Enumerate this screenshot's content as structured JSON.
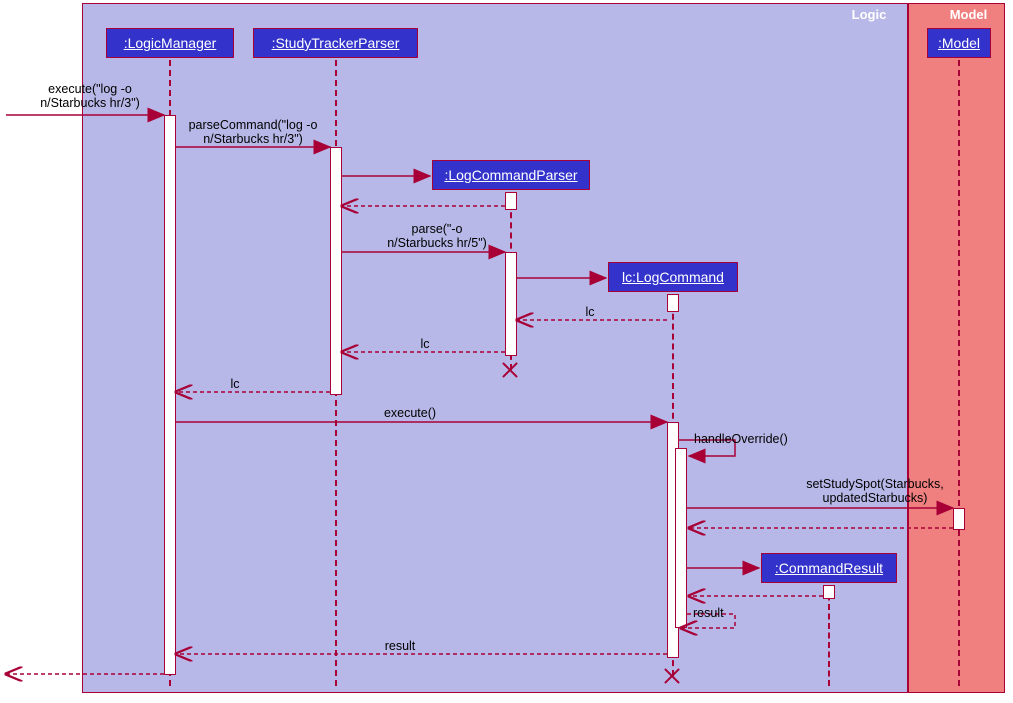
{
  "frames": {
    "logic": {
      "label": "Logic"
    },
    "model": {
      "label": "Model"
    }
  },
  "lifelines": {
    "lm": {
      "label": ":LogicManager"
    },
    "stp": {
      "label": ":StudyTrackerParser"
    },
    "lcp": {
      "label": ":LogCommandParser"
    },
    "lc": {
      "label": "lc:LogCommand"
    },
    "mdl": {
      "label": ":Model"
    },
    "cr": {
      "label": ":CommandResult"
    }
  },
  "messages": {
    "m1": "execute(\"log -o\nn/Starbucks hr/3\")",
    "m2": "parseCommand(\"log -o\nn/Starbucks hr/3\")",
    "m3": "parse(\"-o\nn/Starbucks hr/5\")",
    "m4": "lc",
    "m5": "lc",
    "m6": "lc",
    "m7": "execute()",
    "m8": "handleOverride()",
    "m9": "setStudySpot(Starbucks,\nupdatedStarbucks)",
    "m10": "result",
    "m11": "result"
  }
}
